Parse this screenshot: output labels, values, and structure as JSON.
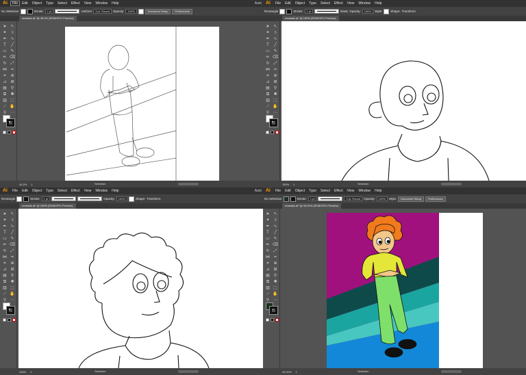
{
  "app": {
    "logo": "Ai",
    "menus": [
      "File",
      "Edit",
      "Object",
      "Type",
      "Select",
      "Effect",
      "View",
      "Window",
      "Help"
    ],
    "menu_extra": "Auto"
  },
  "control_bar": {
    "selection_tl": "No Selection",
    "selection_other": "Rectangle",
    "stroke_label": "Stroke:",
    "stroke_value": "1 pt",
    "uniform": "Uniform",
    "brush_tl": "3 pt. Round",
    "brush_tr": "Basic",
    "opacity_label": "Opacity:",
    "opacity_value": "100%",
    "style_label": "Style:",
    "document_setup": "Document Setup",
    "preferences": "Preferences",
    "shape": "Shape:",
    "transform": "Transform"
  },
  "panels": [
    {
      "id": "tl",
      "tab": "newtask.ai* @ 45.2% (RGB/GPU Preview)",
      "zoom": "45.2%",
      "page": "1",
      "status": "Selection",
      "fill": "white"
    },
    {
      "id": "tr",
      "tab": "newtask.ai* @ 150% (RGB/GPU Preview)",
      "zoom": "150%",
      "page": "1",
      "status": "Selection",
      "fill": "white"
    },
    {
      "id": "bl",
      "tab": "newtask.ai* @ 150% (RGB/GPU Preview)",
      "zoom": "150%",
      "page": "1",
      "status": "Selection",
      "fill": "white"
    },
    {
      "id": "br",
      "tab": "newtask.ai* @ 43.92% (RGB/GPU Preview)",
      "zoom": "43.92%",
      "page": "1",
      "status": "Selection",
      "fill": "dark-green"
    }
  ],
  "tools": [
    "arrow-icon",
    "direct-select-icon",
    "magic-wand-icon",
    "lasso-icon",
    "pen-icon",
    "curvature-icon",
    "type-icon",
    "line-icon",
    "rectangle-icon",
    "paintbrush-icon",
    "pencil-icon",
    "eraser-icon",
    "rotate-icon",
    "scale-icon",
    "width-icon",
    "warp-icon",
    "free-transform-icon",
    "shape-builder-icon",
    "perspective-icon",
    "mesh-icon",
    "gradient-icon",
    "eyedropper-icon",
    "blend-icon",
    "symbol-sprayer-icon",
    "graph-icon",
    "artboard-icon",
    "slice-icon",
    "hand-icon",
    "zoom-icon",
    "more-icon"
  ],
  "colors": {
    "ui_dark": "#323232",
    "ui_mid": "#424242",
    "ui_canvas": "#535353",
    "ai_orange": "#ff9a00",
    "bg_magenta": "#a0117e",
    "stripe_dark_teal": "#0f4a4a",
    "stripe_teal": "#1ba5a0",
    "stripe_light_teal": "#48c7c0",
    "stripe_blue": "#1488d8",
    "hair_orange": "#f07a1c",
    "skin": "#f3c78a",
    "shirt_yellow": "#e4e638",
    "pants_green": "#7ee06a",
    "shoes_black": "#111111"
  }
}
